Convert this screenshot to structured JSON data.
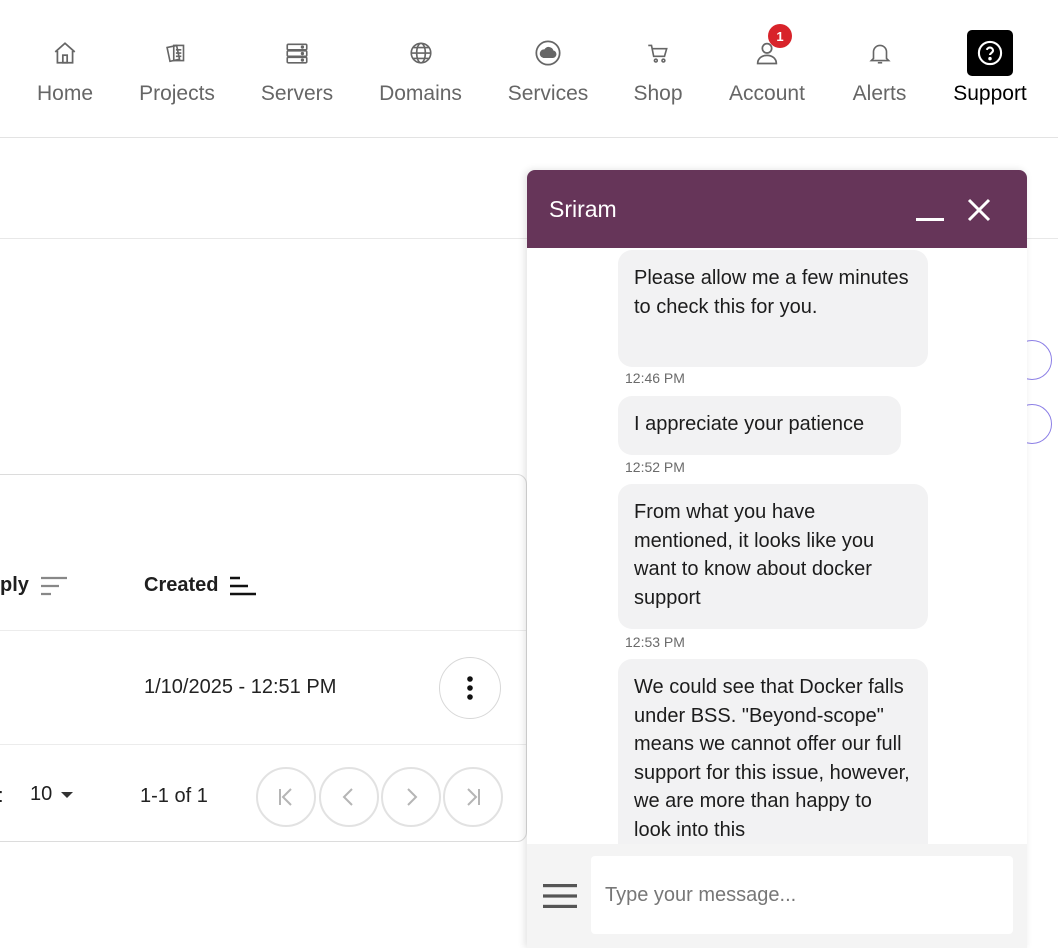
{
  "nav": {
    "items": [
      {
        "label": "Home",
        "icon": "home-icon"
      },
      {
        "label": "Projects",
        "icon": "projects-icon"
      },
      {
        "label": "Servers",
        "icon": "servers-icon"
      },
      {
        "label": "Domains",
        "icon": "globe-icon"
      },
      {
        "label": "Services",
        "icon": "cloud-icon"
      },
      {
        "label": "Shop",
        "icon": "cart-icon"
      },
      {
        "label": "Account",
        "icon": "user-icon",
        "badge": "1"
      },
      {
        "label": "Alerts",
        "icon": "bell-icon"
      },
      {
        "label": "Support",
        "icon": "question-icon",
        "active": true
      }
    ]
  },
  "table": {
    "col_apply": "ply",
    "col_created": "Created",
    "row_created": "1/10/2025 - 12:51 PM",
    "rows_per_page_label": ":",
    "rows_per_page": "10",
    "range": "1-1 of 1"
  },
  "chat": {
    "agent_name": "Sriram",
    "messages": [
      {
        "text": "Please allow me a few minutes to check this for you.",
        "time": "12:46 PM"
      },
      {
        "text": "I appreciate your patience",
        "time": "12:52 PM"
      },
      {
        "text": "From what you have mentioned, it looks like you want to know about docker support",
        "time": "12:53 PM"
      },
      {
        "text": "We could see that Docker falls under BSS. \"Beyond-scope\" means we cannot offer our full support for this issue, however, we are more than happy to look into this",
        "time": ""
      }
    ],
    "input_placeholder": "Type your message...",
    "colors": {
      "header": "#663559",
      "bubble": "#f2f2f3",
      "badge": "#d8232a"
    }
  }
}
